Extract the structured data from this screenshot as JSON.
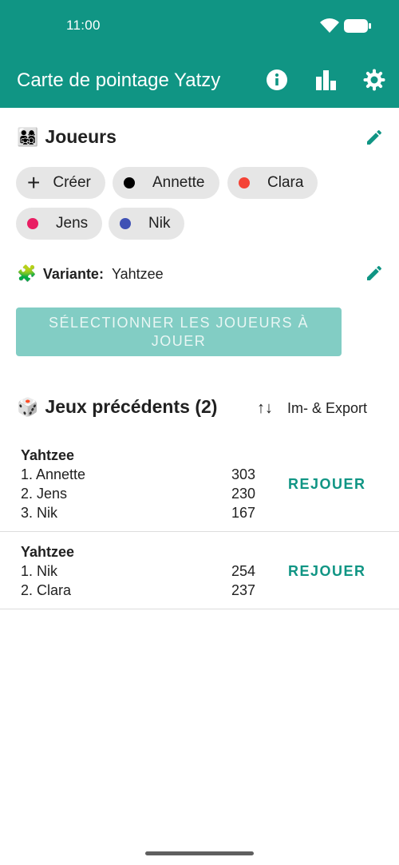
{
  "status_bar": {
    "time": "11:00",
    "wifi_icon": "wifi-icon",
    "battery_icon": "battery-icon"
  },
  "app_bar": {
    "title": "Carte de pointage Yatzy",
    "actions": [
      {
        "name": "info-icon"
      },
      {
        "name": "bar-chart-icon"
      },
      {
        "name": "settings-gear-icon"
      }
    ]
  },
  "players_section": {
    "emoji": "👨‍👩‍👧‍👦",
    "title": "Joueurs",
    "create_label": "Créer",
    "chips": [
      {
        "name": "Annette",
        "color": "#000000"
      },
      {
        "name": "Clara",
        "color": "#f44336"
      },
      {
        "name": "Jens",
        "color": "#e91e63"
      },
      {
        "name": "Nik",
        "color": "#3f51b5"
      }
    ]
  },
  "variant": {
    "emoji": "🧩",
    "label": "Variante:",
    "value": "Yahtzee"
  },
  "select_button": {
    "label": "SÉLECTIONNER LES JOUEURS À JOUER"
  },
  "previous_games": {
    "emoji": "🎲",
    "title": "Jeux précédents (2)",
    "export_label": "Im- & Export",
    "export_icon": "↑↓",
    "games": [
      {
        "title": "Yahtzee",
        "replay_label": "REJOUER",
        "results": [
          {
            "player": "1. Annette",
            "score": "303"
          },
          {
            "player": "2. Jens",
            "score": "230"
          },
          {
            "player": "3. Nik",
            "score": "167"
          }
        ]
      },
      {
        "title": "Yahtzee",
        "replay_label": "REJOUER",
        "results": [
          {
            "player": "1. Nik",
            "score": "254"
          },
          {
            "player": "2. Clara",
            "score": "237"
          }
        ]
      }
    ]
  },
  "colors": {
    "primary": "#109584",
    "disabled_button": "#82cdc4",
    "chip_bg": "#e6e6e6"
  }
}
